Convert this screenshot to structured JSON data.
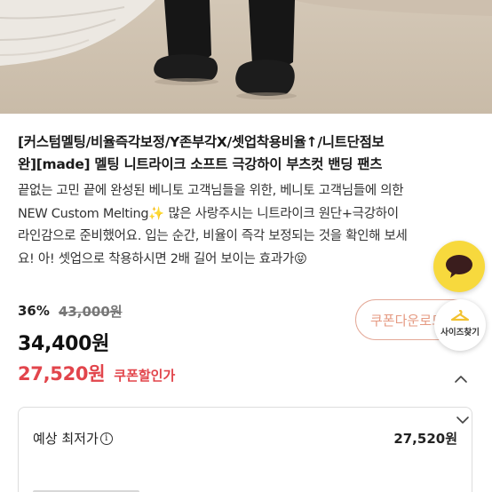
{
  "product": {
    "title_lines": [
      "[커스텀멜팅/비율즉각보정/Y존부각X/셋업착용비율↑/니트단점보",
      "완][made] 멜팅 니트라이크 소프트 극강하이 부츠컷 밴딩 팬츠"
    ],
    "description_lines": [
      "끝없는 고민 끝에 완성된 베니토 고객님들을 위한, 베니토 고객님들에 의한",
      "NEW Custom Melting✨ 많은 사랑주시는 니트라이크 원단+극강하이",
      "라인감으로 준비했어요. 입는 순간, 비율이 즉각 보정되는 것을 확인해 보세",
      "요! 아! 셋업으로 착용하시면 2배 길어 보이는 효과가😝"
    ]
  },
  "pricing": {
    "discount_rate": "36%",
    "original_price": "43,000원",
    "price": "34,400원",
    "coupon_price": "27,520원",
    "coupon_label": "쿠폰할인가"
  },
  "buttons": {
    "coupon_download": "쿠폰다운로드",
    "size_finder": "사이즈찾기"
  },
  "lowest_price": {
    "label": "예상 최저가",
    "info_glyph": "i",
    "value": "27,520원"
  },
  "icons": {
    "chat": "kakao-chat-icon",
    "size_finder": "hanger-icon",
    "collapse": "chevron-up-icon",
    "expand": "chevron-down-icon"
  },
  "colors": {
    "coupon_red": "#e2454c",
    "coupon_border": "#e4a998",
    "kakao_yellow": "#f7d93d",
    "size_icon_yellow": "#f2c230"
  }
}
